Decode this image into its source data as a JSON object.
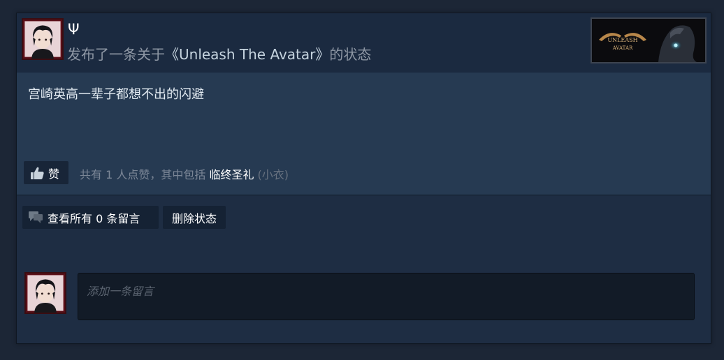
{
  "post": {
    "author_name": "Ψ",
    "action_prefix": "发布了一条关于",
    "game_title": "《Unleash The Avatar》",
    "action_suffix": "的状态",
    "game_thumb_text_1": "UNLEASH",
    "game_thumb_text_2": "AVATAR",
    "status_text": "宫崎英高一辈子都想不出的闪避"
  },
  "likes": {
    "button_label": "赞",
    "summary_prefix": "共有 1 人点赞，其中包括 ",
    "liker_name": "临终圣礼",
    "liker_nickname": " (小衣)"
  },
  "actions": {
    "view_comments_label": "查看所有 0 条留言",
    "delete_label": "删除状态"
  },
  "comment": {
    "placeholder": "添加一条留言"
  },
  "colors": {
    "card_bg": "#1e2d43",
    "body_bg": "#263a52",
    "accent_link": "#ffffff",
    "muted_text": "#8f98a5"
  }
}
